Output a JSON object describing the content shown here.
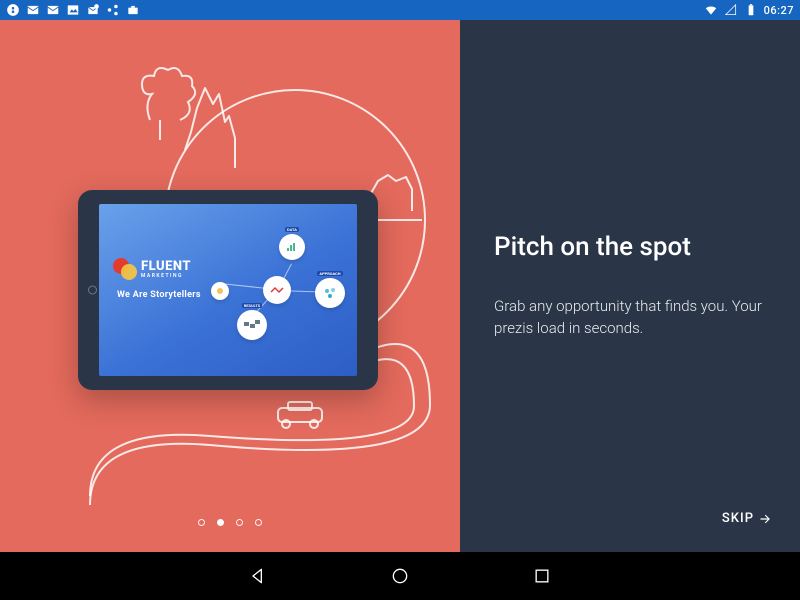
{
  "statusbar": {
    "clock": "06:27"
  },
  "onboarding": {
    "title": "Pitch on the spot",
    "body": "Grab any opportunity that finds you. Your prezis load in seconds.",
    "skip_label": "SKIP",
    "current_page": 1,
    "total_pages": 4
  },
  "tablet_content": {
    "brand_name": "FLUENT",
    "brand_sub": "MARKETING",
    "tagline": "We Are Storytellers",
    "nodes": {
      "data": "DATA",
      "approach": "APPROACH",
      "results": "RESULTS"
    }
  }
}
